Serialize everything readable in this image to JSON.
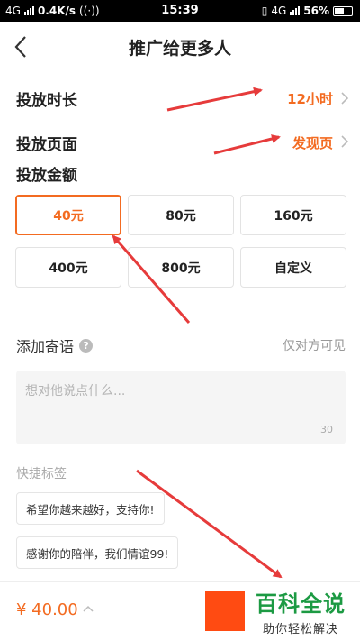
{
  "status": {
    "left_net": "4G",
    "speed": "0.4K/s",
    "time": "15:39",
    "right_net": "4G",
    "battery": "56%"
  },
  "header": {
    "title": "推广给更多人"
  },
  "duration": {
    "label": "投放时长",
    "value": "12小时"
  },
  "page": {
    "label": "投放页面",
    "value": "发现页"
  },
  "amount": {
    "label": "投放金额",
    "options": [
      "40元",
      "80元",
      "160元",
      "400元",
      "800元",
      "自定义"
    ],
    "selected_index": 0
  },
  "message": {
    "title": "添加寄语",
    "visibility_note": "仅对方可见",
    "placeholder": "想对他说点什么...",
    "counter": "30"
  },
  "quick_tags": {
    "title": "快捷标签",
    "tags": [
      "希望你越来越好，支持你!",
      "感谢你的陪伴，我们情谊99!"
    ]
  },
  "bottom": {
    "price": "¥ 40.00"
  },
  "watermark": {
    "main": "百科全说",
    "sub": "助你轻松解决"
  },
  "colors": {
    "accent": "#f36b21",
    "arrow": "#e63b3b",
    "button": "#ff4b12",
    "watermark": "#1c9a43"
  }
}
